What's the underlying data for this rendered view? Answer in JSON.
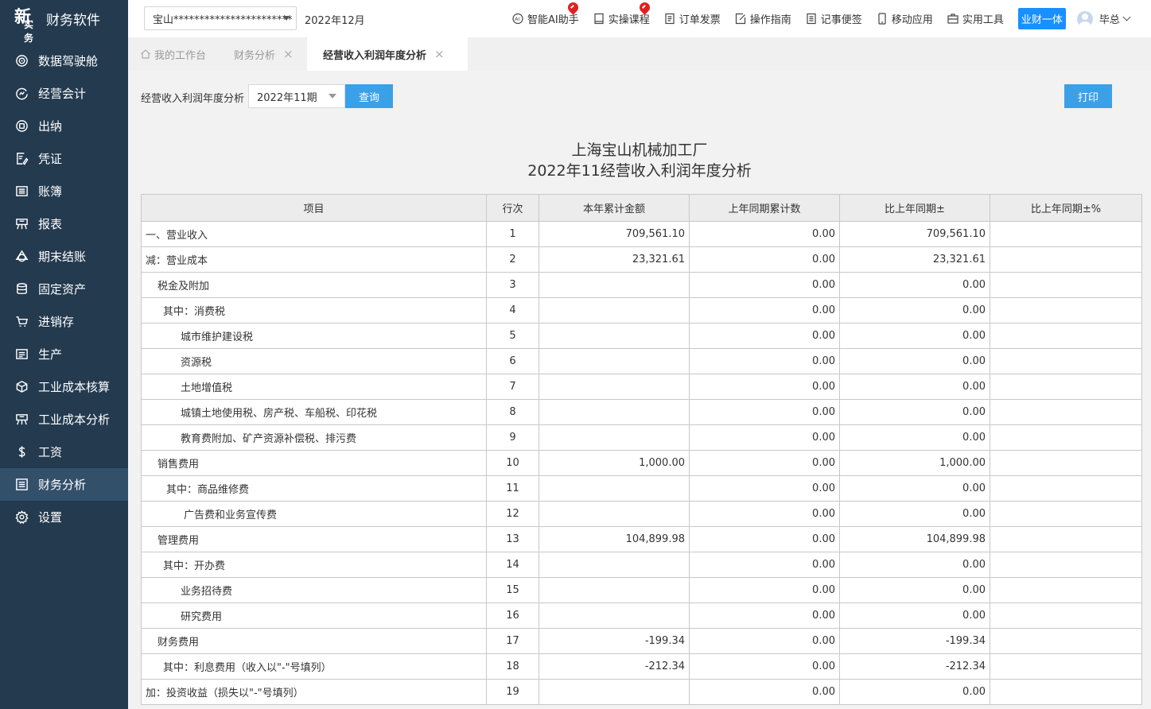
{
  "brand": {
    "logo_top": "新",
    "logo_bottom": "实务",
    "name": "财务软件"
  },
  "sidebar": {
    "items": [
      {
        "label": "数据驾驶舱",
        "icon": "radar-icon",
        "active": false
      },
      {
        "label": "经营会计",
        "icon": "refresh-chart-icon",
        "active": false
      },
      {
        "label": "出纳",
        "icon": "target-icon",
        "active": false
      },
      {
        "label": "凭证",
        "icon": "voucher-edit-icon",
        "active": false
      },
      {
        "label": "账簿",
        "icon": "ledger-icon",
        "active": false
      },
      {
        "label": "报表",
        "icon": "report-icon",
        "active": false
      },
      {
        "label": "期末结账",
        "icon": "cycle-icon",
        "active": false
      },
      {
        "label": "固定资产",
        "icon": "database-icon",
        "active": false
      },
      {
        "label": "进销存",
        "icon": "cart-icon",
        "active": false
      },
      {
        "label": "生产",
        "icon": "production-icon",
        "active": false
      },
      {
        "label": "工业成本核算",
        "icon": "cube-icon",
        "active": false
      },
      {
        "label": "工业成本分析",
        "icon": "analysis-icon",
        "active": false
      },
      {
        "label": "工资",
        "icon": "dollar-icon",
        "active": false
      },
      {
        "label": "财务分析",
        "icon": "financial-analysis-icon",
        "active": true
      },
      {
        "label": "设置",
        "icon": "gear-icon",
        "active": false
      }
    ]
  },
  "header": {
    "company": "宝山***********************",
    "period": "2022年12月",
    "tools": [
      {
        "label": "智能AI助手",
        "icon": "ai-icon",
        "hot": true
      },
      {
        "label": "实操课程",
        "icon": "course-icon",
        "hot": true
      },
      {
        "label": "订单发票",
        "icon": "invoice-icon",
        "hot": false
      },
      {
        "label": "操作指南",
        "icon": "guide-icon",
        "hot": false
      },
      {
        "label": "记事便签",
        "icon": "note-icon",
        "hot": false
      },
      {
        "label": "移动应用",
        "icon": "mobile-icon",
        "hot": false
      },
      {
        "label": "实用工具",
        "icon": "toolbox-icon",
        "hot": false
      }
    ],
    "badge": "业财一体",
    "user": "毕总"
  },
  "tabs": [
    {
      "label": "我的工作台",
      "closable": false
    },
    {
      "label": "财务分析",
      "closable": true
    },
    {
      "label": "经营收入利润年度分析",
      "closable": true,
      "active": true
    }
  ],
  "filter": {
    "label": "经营收入利润年度分析",
    "period_value": "2022年11期",
    "query_label": "查询",
    "print_label": "打印"
  },
  "report": {
    "company": "上海宝山机械加工厂",
    "title": "2022年11经营收入利润年度分析",
    "columns": [
      "项目",
      "行次",
      "本年累计金额",
      "上年同期累计数",
      "比上年同期±",
      "比上年同期±%"
    ],
    "rows": [
      {
        "item": "一、营业收入",
        "indent": "ind0",
        "line": "1",
        "current": "709,561.10",
        "prior": "0.00",
        "diff": "709,561.10",
        "pct": ""
      },
      {
        "item": "减：营业成本",
        "indent": "ind0",
        "line": "2",
        "current": "23,321.61",
        "prior": "0.00",
        "diff": "23,321.61",
        "pct": ""
      },
      {
        "item": "税金及附加",
        "indent": "ind1",
        "line": "3",
        "current": "",
        "prior": "0.00",
        "diff": "0.00",
        "pct": ""
      },
      {
        "item": "其中：消费税",
        "indent": "ind2",
        "line": "4",
        "current": "",
        "prior": "0.00",
        "diff": "0.00",
        "pct": ""
      },
      {
        "item": "城市维护建设税",
        "indent": "ind3",
        "line": "5",
        "current": "",
        "prior": "0.00",
        "diff": "0.00",
        "pct": ""
      },
      {
        "item": "资源税",
        "indent": "ind3",
        "line": "6",
        "current": "",
        "prior": "0.00",
        "diff": "0.00",
        "pct": ""
      },
      {
        "item": "土地增值税",
        "indent": "ind3",
        "line": "7",
        "current": "",
        "prior": "0.00",
        "diff": "0.00",
        "pct": ""
      },
      {
        "item": "城镇土地使用税、房产税、车船税、印花税",
        "indent": "ind3",
        "line": "8",
        "current": "",
        "prior": "0.00",
        "diff": "0.00",
        "pct": ""
      },
      {
        "item": "教育费附加、矿产资源补偿税、排污费",
        "indent": "ind3",
        "line": "9",
        "current": "",
        "prior": "0.00",
        "diff": "0.00",
        "pct": ""
      },
      {
        "item": "销售费用",
        "indent": "ind1",
        "line": "10",
        "current": "1,000.00",
        "prior": "0.00",
        "diff": "1,000.00",
        "pct": ""
      },
      {
        "item": "其中：商品维修费",
        "indent": "ind2b",
        "line": "11",
        "current": "",
        "prior": "0.00",
        "diff": "0.00",
        "pct": ""
      },
      {
        "item": "广告费和业务宣传费",
        "indent": "ind3b",
        "line": "12",
        "current": "",
        "prior": "0.00",
        "diff": "0.00",
        "pct": ""
      },
      {
        "item": "管理费用",
        "indent": "ind1",
        "line": "13",
        "current": "104,899.98",
        "prior": "0.00",
        "diff": "104,899.98",
        "pct": ""
      },
      {
        "item": "其中：开办费",
        "indent": "ind2",
        "line": "14",
        "current": "",
        "prior": "0.00",
        "diff": "0.00",
        "pct": ""
      },
      {
        "item": "业务招待费",
        "indent": "ind3",
        "line": "15",
        "current": "",
        "prior": "0.00",
        "diff": "0.00",
        "pct": ""
      },
      {
        "item": "研究费用",
        "indent": "ind3",
        "line": "16",
        "current": "",
        "prior": "0.00",
        "diff": "0.00",
        "pct": ""
      },
      {
        "item": "财务费用",
        "indent": "ind1",
        "line": "17",
        "current": "-199.34",
        "prior": "0.00",
        "diff": "-199.34",
        "pct": ""
      },
      {
        "item": "其中：利息费用（收入以\"-\"号填列）",
        "indent": "ind2",
        "line": "18",
        "current": "-212.34",
        "prior": "0.00",
        "diff": "-212.34",
        "pct": ""
      },
      {
        "item": "加：投资收益（损失以\"-\"号填列）",
        "indent": "ind0",
        "line": "19",
        "current": "",
        "prior": "0.00",
        "diff": "0.00",
        "pct": ""
      }
    ]
  }
}
